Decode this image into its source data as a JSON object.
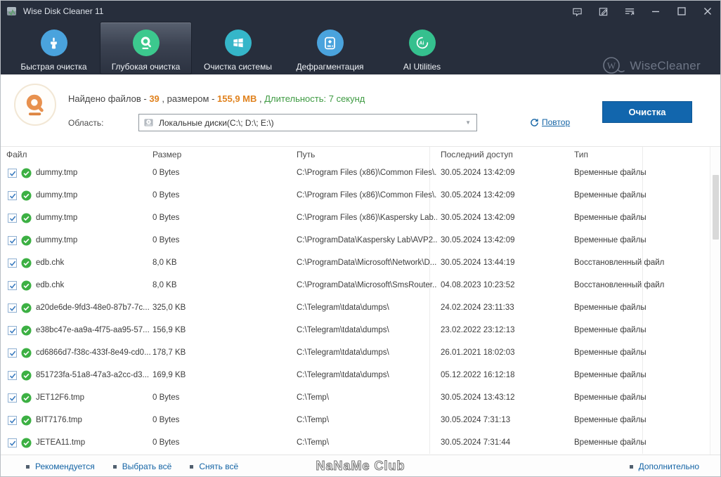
{
  "titlebar": {
    "title": "Wise Disk Cleaner 11",
    "buttons": [
      {
        "name": "feedback",
        "icon": "chat-bubble-icon"
      },
      {
        "name": "register",
        "icon": "edit-note-icon"
      },
      {
        "name": "main-menu",
        "icon": "menu-arrow-icon"
      },
      {
        "name": "minimize",
        "icon": "minimize-icon"
      },
      {
        "name": "maximize",
        "icon": "maximize-icon"
      },
      {
        "name": "close",
        "icon": "close-icon"
      }
    ]
  },
  "tabs": [
    {
      "label": "Быстрая очистка",
      "icon": "brush-icon",
      "color": "#4aa3dd",
      "selected": false
    },
    {
      "label": "Глубокая очистка",
      "icon": "disk-scan-icon",
      "color": "#3cc98e",
      "selected": true
    },
    {
      "label": "Очистка системы",
      "icon": "windows-icon",
      "color": "#35b6c9",
      "selected": false
    },
    {
      "label": "Дефрагментация",
      "icon": "defrag-disk-icon",
      "color": "#4aa3dd",
      "selected": false
    },
    {
      "label": "AI Utilities",
      "icon": "ai-swirl-icon",
      "color": "#35c08e",
      "selected": false
    }
  ],
  "brand": {
    "name": "WiseCleaner"
  },
  "summary": {
    "found_label": "Найдено файлов - ",
    "found_count": "39",
    "size_label": " , размером - ",
    "size_value": "155,9 MB",
    "separator": " , ",
    "duration": "Длительность: 7 секунд"
  },
  "scope": {
    "label": "Область:",
    "value": "Локальные диски(C:\\; D:\\; E:\\)"
  },
  "actions": {
    "repeat": "Повтор",
    "clean": "Очистка"
  },
  "table": {
    "columns": [
      "Файл",
      "Размер",
      "Путь",
      "Последний доступ",
      "Тип"
    ],
    "rows": [
      {
        "checked": true,
        "file": "dummy.tmp",
        "size": "0 Bytes",
        "path": "C:\\Program Files (x86)\\Common Files\\...",
        "accessed": "30.05.2024 13:42:09",
        "type": "Временные файлы"
      },
      {
        "checked": true,
        "file": "dummy.tmp",
        "size": "0 Bytes",
        "path": "C:\\Program Files (x86)\\Common Files\\...",
        "accessed": "30.05.2024 13:42:09",
        "type": "Временные файлы"
      },
      {
        "checked": true,
        "file": "dummy.tmp",
        "size": "0 Bytes",
        "path": "C:\\Program Files (x86)\\Kaspersky Lab...",
        "accessed": "30.05.2024 13:42:09",
        "type": "Временные файлы"
      },
      {
        "checked": true,
        "file": "dummy.tmp",
        "size": "0 Bytes",
        "path": "C:\\ProgramData\\Kaspersky Lab\\AVP2...",
        "accessed": "30.05.2024 13:42:09",
        "type": "Временные файлы"
      },
      {
        "checked": true,
        "file": "edb.chk",
        "size": "8,0 KB",
        "path": "C:\\ProgramData\\Microsoft\\Network\\D...",
        "accessed": "30.05.2024 13:44:19",
        "type": "Восстановленный файл"
      },
      {
        "checked": true,
        "file": "edb.chk",
        "size": "8,0 KB",
        "path": "C:\\ProgramData\\Microsoft\\SmsRouter...",
        "accessed": "04.08.2023 10:23:52",
        "type": "Восстановленный файл"
      },
      {
        "checked": true,
        "file": "a20de6de-9fd3-48e0-87b7-7c...",
        "size": "325,0 KB",
        "path": "C:\\Telegram\\tdata\\dumps\\",
        "accessed": "24.02.2024 23:11:33",
        "type": "Временные файлы"
      },
      {
        "checked": true,
        "file": "e38bc47e-aa9a-4f75-aa95-57...",
        "size": "156,9 KB",
        "path": "C:\\Telegram\\tdata\\dumps\\",
        "accessed": "23.02.2022 23:12:13",
        "type": "Временные файлы"
      },
      {
        "checked": true,
        "file": "cd6866d7-f38c-433f-8e49-cd0...",
        "size": "178,7 KB",
        "path": "C:\\Telegram\\tdata\\dumps\\",
        "accessed": "26.01.2021 18:02:03",
        "type": "Временные файлы"
      },
      {
        "checked": true,
        "file": "851723fa-51a8-47a3-a2cc-d3...",
        "size": "169,9 KB",
        "path": "C:\\Telegram\\tdata\\dumps\\",
        "accessed": "05.12.2022 16:12:18",
        "type": "Временные файлы"
      },
      {
        "checked": true,
        "file": "JET12F6.tmp",
        "size": "0 Bytes",
        "path": "C:\\Temp\\",
        "accessed": "30.05.2024 13:43:12",
        "type": "Временные файлы"
      },
      {
        "checked": true,
        "file": "BIT7176.tmp",
        "size": "0 Bytes",
        "path": "C:\\Temp\\",
        "accessed": "30.05.2024 7:31:13",
        "type": "Временные файлы"
      },
      {
        "checked": true,
        "file": "JETEA11.tmp",
        "size": "0 Bytes",
        "path": "C:\\Temp\\",
        "accessed": "30.05.2024 7:31:44",
        "type": "Временные файлы"
      }
    ]
  },
  "footer": {
    "links": [
      "Рекомендуется",
      "Выбрать всё",
      "Снять всё"
    ],
    "more": "Дополнительно",
    "watermark": "NaNaMe Club"
  },
  "colors": {
    "titlebar_bg": "#272e3c",
    "button_blue": "#1266ad",
    "link_blue": "#1464a5",
    "count_orange": "#e0821e",
    "duration_green": "#3f9b43",
    "row_check_green": "#3cb043",
    "scan_badge_orange": "#e8914e"
  }
}
